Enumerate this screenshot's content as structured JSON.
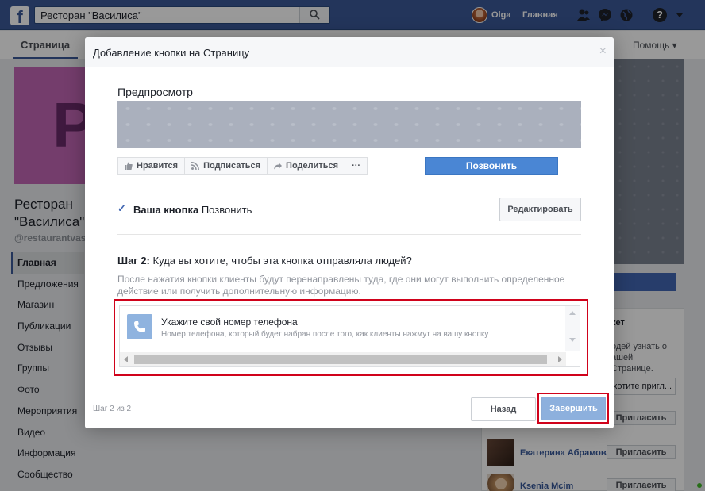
{
  "topbar": {
    "search_value": "Ресторан \"Василиса\"",
    "user_name": "Olga",
    "home_label": "Главная"
  },
  "page": {
    "tab_label": "Страница",
    "help_menu": "Помощь ▾",
    "name": "Ресторан \"Василиса\"",
    "handle": "@restaurantvas",
    "nav": [
      "Главная",
      "Предложения",
      "Магазин",
      "Публикации",
      "Отзывы",
      "Группы",
      "Фото",
      "Мероприятия",
      "Видео",
      "Информация",
      "Сообщество"
    ]
  },
  "right_panel": {
    "title": "кет",
    "text": "одей узнать о ашей Странице.",
    "invite_placeholder": "хотите пригл...",
    "invite_label": "Пригласить",
    "friends": [
      "Екатерина Абрамова",
      "Ksenia Mcim"
    ]
  },
  "modal": {
    "title": "Добавление кнопки на Страницу",
    "close": "×",
    "preview_title": "Предпросмотр",
    "actions": {
      "like": "Нравится",
      "follow": "Подписаться",
      "share": "Поделиться",
      "more": "···"
    },
    "call_label": "Позвонить",
    "your_button_label": "Ваша кнопка",
    "your_button_value": "Позвонить",
    "edit_label": "Редактировать",
    "step_label": "Шаг 2:",
    "step_question": "Куда вы хотите, чтобы эта кнопка отправляла людей?",
    "step_desc": "После нажатия кнопки клиенты будут перенаправлены туда, где они могут выполнить определенное действие или получить дополнительную информацию.",
    "option_title": "Укажите свой номер телефона",
    "option_sub": "Номер телефона, который будет набран после того, как клиенты нажмут на вашу кнопку",
    "step_count": "Шаг 2 из 2",
    "back_label": "Назад",
    "finish_label": "Завершить"
  }
}
